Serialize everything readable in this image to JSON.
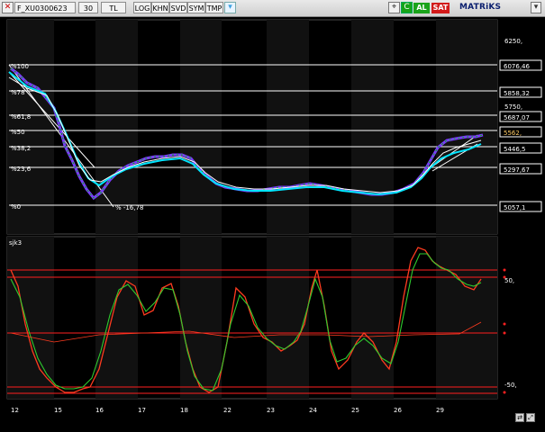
{
  "toolbar": {
    "symbol": "F_XU0300623",
    "period": "30",
    "currency": "TL",
    "buttons": [
      "LOG",
      "KHN",
      "SVD",
      "SYM",
      "TMP"
    ],
    "al_label": "AL",
    "sat_label": "SAT",
    "brand": "MATRiKS"
  },
  "price_panel": {
    "price_levels": [
      "6250,",
      "6076,46",
      "5858,32",
      "5750,",
      "5687,07",
      "5562,",
      "5446,5",
      "5297,67",
      "5057,1"
    ],
    "last_price": "5562,",
    "fib_labels": [
      "%100",
      "%78",
      "%61,8",
      "%50",
      "%38,2",
      "%23,6",
      "%0"
    ],
    "fib_extension_label": "% -16,78",
    "colors": {
      "main_line": "#00e5ff",
      "ma_line": "#ffffff",
      "candles": "#7a3cff",
      "up": "#00c000",
      "fib": "#ffffff"
    }
  },
  "indicator_panel": {
    "label": "sjk3",
    "levels": [
      "50,",
      "-50,"
    ],
    "colors": {
      "fast": "#ff3b1f",
      "slow": "#2ecc2e",
      "bands": "#ff2020"
    }
  },
  "x_axis": {
    "dates": [
      "12",
      "15",
      "16",
      "17",
      "18",
      "22",
      "23",
      "24",
      "25",
      "26",
      "29"
    ]
  }
}
